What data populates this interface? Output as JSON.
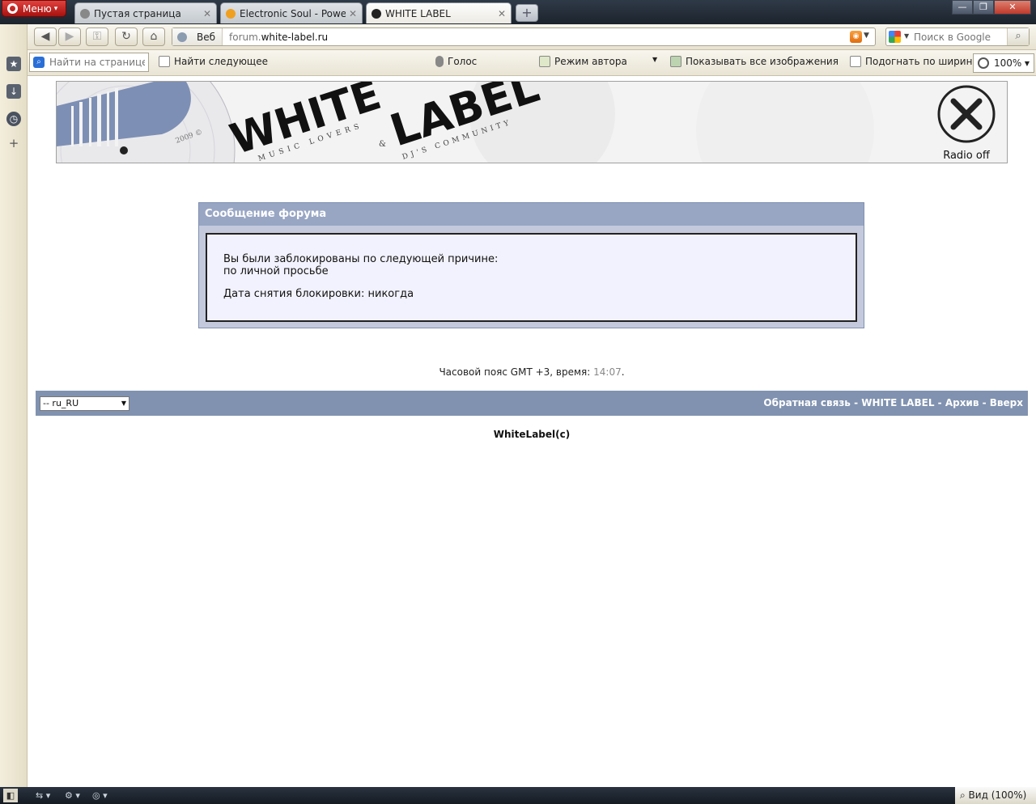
{
  "browser": {
    "menu_label": "Меню",
    "tabs": [
      {
        "title": "Пустая страница",
        "active": false
      },
      {
        "title": "Electronic Soul - Power...",
        "active": false
      },
      {
        "title": "WHITE LABEL",
        "active": true
      }
    ],
    "newtab_symbol": "+",
    "address": {
      "mode_label": "Веб",
      "url_prefix": "forum.",
      "url_host": "white-label.ru"
    },
    "search": {
      "placeholder": "Поиск в Google"
    },
    "toolbar": {
      "find_placeholder": "Найти на странице",
      "find_next": "Найти следующее",
      "voice": "Голос",
      "author_mode": "Режим автора",
      "show_images": "Показывать все изображения",
      "fit_width": "Подогнать по ширине",
      "zoom": "100%"
    },
    "status": {
      "zoom_label": "Вид (100%)"
    }
  },
  "banner": {
    "logo_text_top": "WHITE",
    "logo_text_bottom": "LABEL",
    "tagline_1": "MUSIC LOVERS",
    "tagline_2": "&",
    "tagline_3": "DJ'S COMMUNITY",
    "record_year": "2009 ©",
    "radio_label": "Radio off"
  },
  "message": {
    "title": "Сообщение форума",
    "line1": "Вы были заблокированы по следующей причине:",
    "line2": "по личной просьбе",
    "line3": "Дата снятия блокировки: никогда"
  },
  "timezone": {
    "text": "Часовой пояс GMT +3, время: ",
    "time": "14:07",
    "suffix": "."
  },
  "footer": {
    "language": "-- ru_RU",
    "links": [
      "Обратная связь",
      "WHITE LABEL",
      "Архив",
      "Вверх"
    ],
    "separator": " - ",
    "copyright": "WhiteLabel(c)"
  }
}
